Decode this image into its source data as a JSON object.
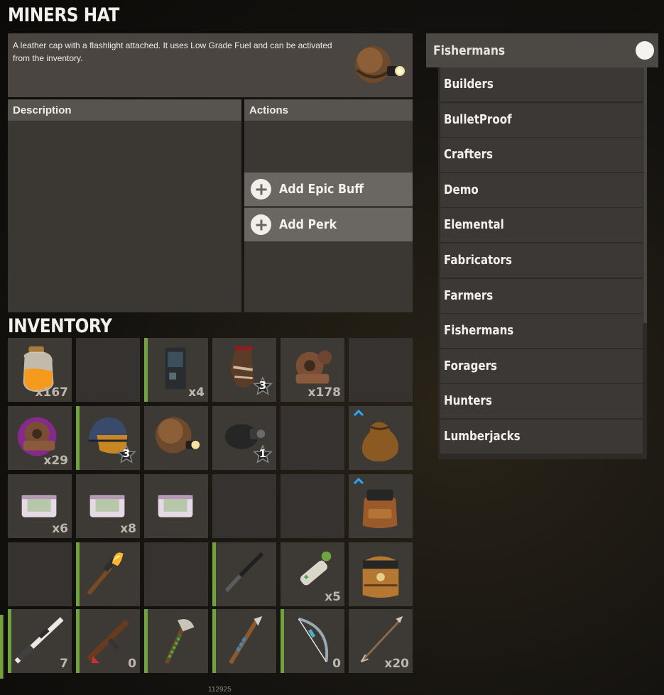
{
  "item": {
    "title": "MINERS HAT",
    "description": "A leather cap with a flashlight attached. It uses Low Grade Fuel and can be activated from the inventory."
  },
  "panels": {
    "description_header": "Description",
    "actions_header": "Actions",
    "actions": [
      "Add Epic Buff",
      "Add Perk"
    ]
  },
  "inventory": {
    "title": "INVENTORY",
    "slots": [
      {
        "item": "low-grade-fuel-jar",
        "count": "x167",
        "condition": false
      },
      {
        "item": "",
        "count": "",
        "condition": false
      },
      {
        "item": "battery",
        "count": "x4",
        "condition": true
      },
      {
        "item": "bone-armor-leg",
        "stars": "3",
        "condition": false
      },
      {
        "item": "gears-scrap",
        "count": "x178",
        "condition": false
      },
      {
        "item": "",
        "count": "",
        "condition": false
      },
      {
        "item": "gears-scrap-epic",
        "count": "x29",
        "condition": false
      },
      {
        "item": "riot-helmet",
        "stars": "3",
        "condition": true
      },
      {
        "item": "miners-hat",
        "condition": false
      },
      {
        "item": "headlamp-diving-mask",
        "stars": "1",
        "condition": false
      },
      {
        "item": "",
        "count": "",
        "condition": false
      },
      {
        "item": "loot-bag",
        "upgrade": true,
        "condition": false
      },
      {
        "item": "supply-crate-small",
        "count": "x6",
        "condition": false
      },
      {
        "item": "supply-crate-small",
        "count": "x8",
        "condition": false
      },
      {
        "item": "supply-crate-small",
        "condition": false
      },
      {
        "item": "",
        "count": "",
        "condition": false
      },
      {
        "item": "",
        "count": "",
        "condition": false
      },
      {
        "item": "backpack-medium",
        "upgrade": true,
        "condition": false
      },
      {
        "item": "",
        "count": "",
        "condition": false
      },
      {
        "item": "torch",
        "condition": true
      },
      {
        "item": "",
        "count": "",
        "condition": false
      },
      {
        "item": "combat-knife",
        "condition": true
      },
      {
        "item": "medical-syringe",
        "count": "x5",
        "condition": false
      },
      {
        "item": "backpack-large",
        "condition": false
      },
      {
        "item": "sniper-rifle",
        "count": "7",
        "condition": true
      },
      {
        "item": "assault-rifle",
        "count": "0",
        "condition": true
      },
      {
        "item": "stone-hatchet",
        "condition": true
      },
      {
        "item": "spear",
        "condition": true
      },
      {
        "item": "hunting-bow",
        "count": "0",
        "condition": true
      },
      {
        "item": "arrow",
        "count": "x20",
        "condition": false
      }
    ]
  },
  "dropdown": {
    "selected": "Fishermans",
    "options": [
      "Builders",
      "BulletProof",
      "Crafters",
      "Demo",
      "Elemental",
      "Fabricators",
      "Farmers",
      "Fishermans",
      "Foragers",
      "Hunters",
      "Lumberjacks"
    ]
  },
  "footer": {
    "id": "112925"
  },
  "colors": {
    "condition_bar": "#72a23a",
    "panel": "#3b3835",
    "header": "#57534e",
    "button": "#6a6661",
    "epic_glow": "#c31bd6",
    "upgrade_arrow": "#2aa6ff"
  }
}
